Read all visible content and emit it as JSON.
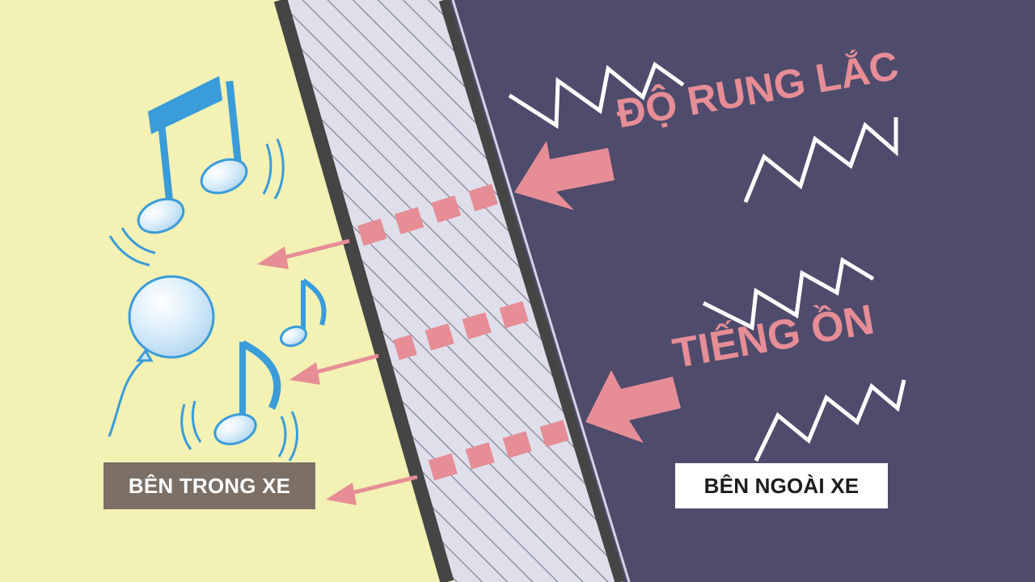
{
  "diagram": {
    "vibration_label": "ĐỘ RUNG LẮC",
    "noise_label": "TIẾNG ỒN",
    "inside_label": "BÊN TRONG XE",
    "outside_label": "BÊN NGOÀI XE"
  },
  "colors": {
    "inside_background": "#f3f1b4",
    "outside_background": "#4e4b6c",
    "wall_fill": "#dedfea",
    "wall_edge": "#454545",
    "accent_pink": "#e68d96",
    "note_blue": "#3a9cd9"
  },
  "icons": [
    "music-note-icon",
    "balloon-icon",
    "zigzag-icon",
    "arrow-icon"
  ]
}
